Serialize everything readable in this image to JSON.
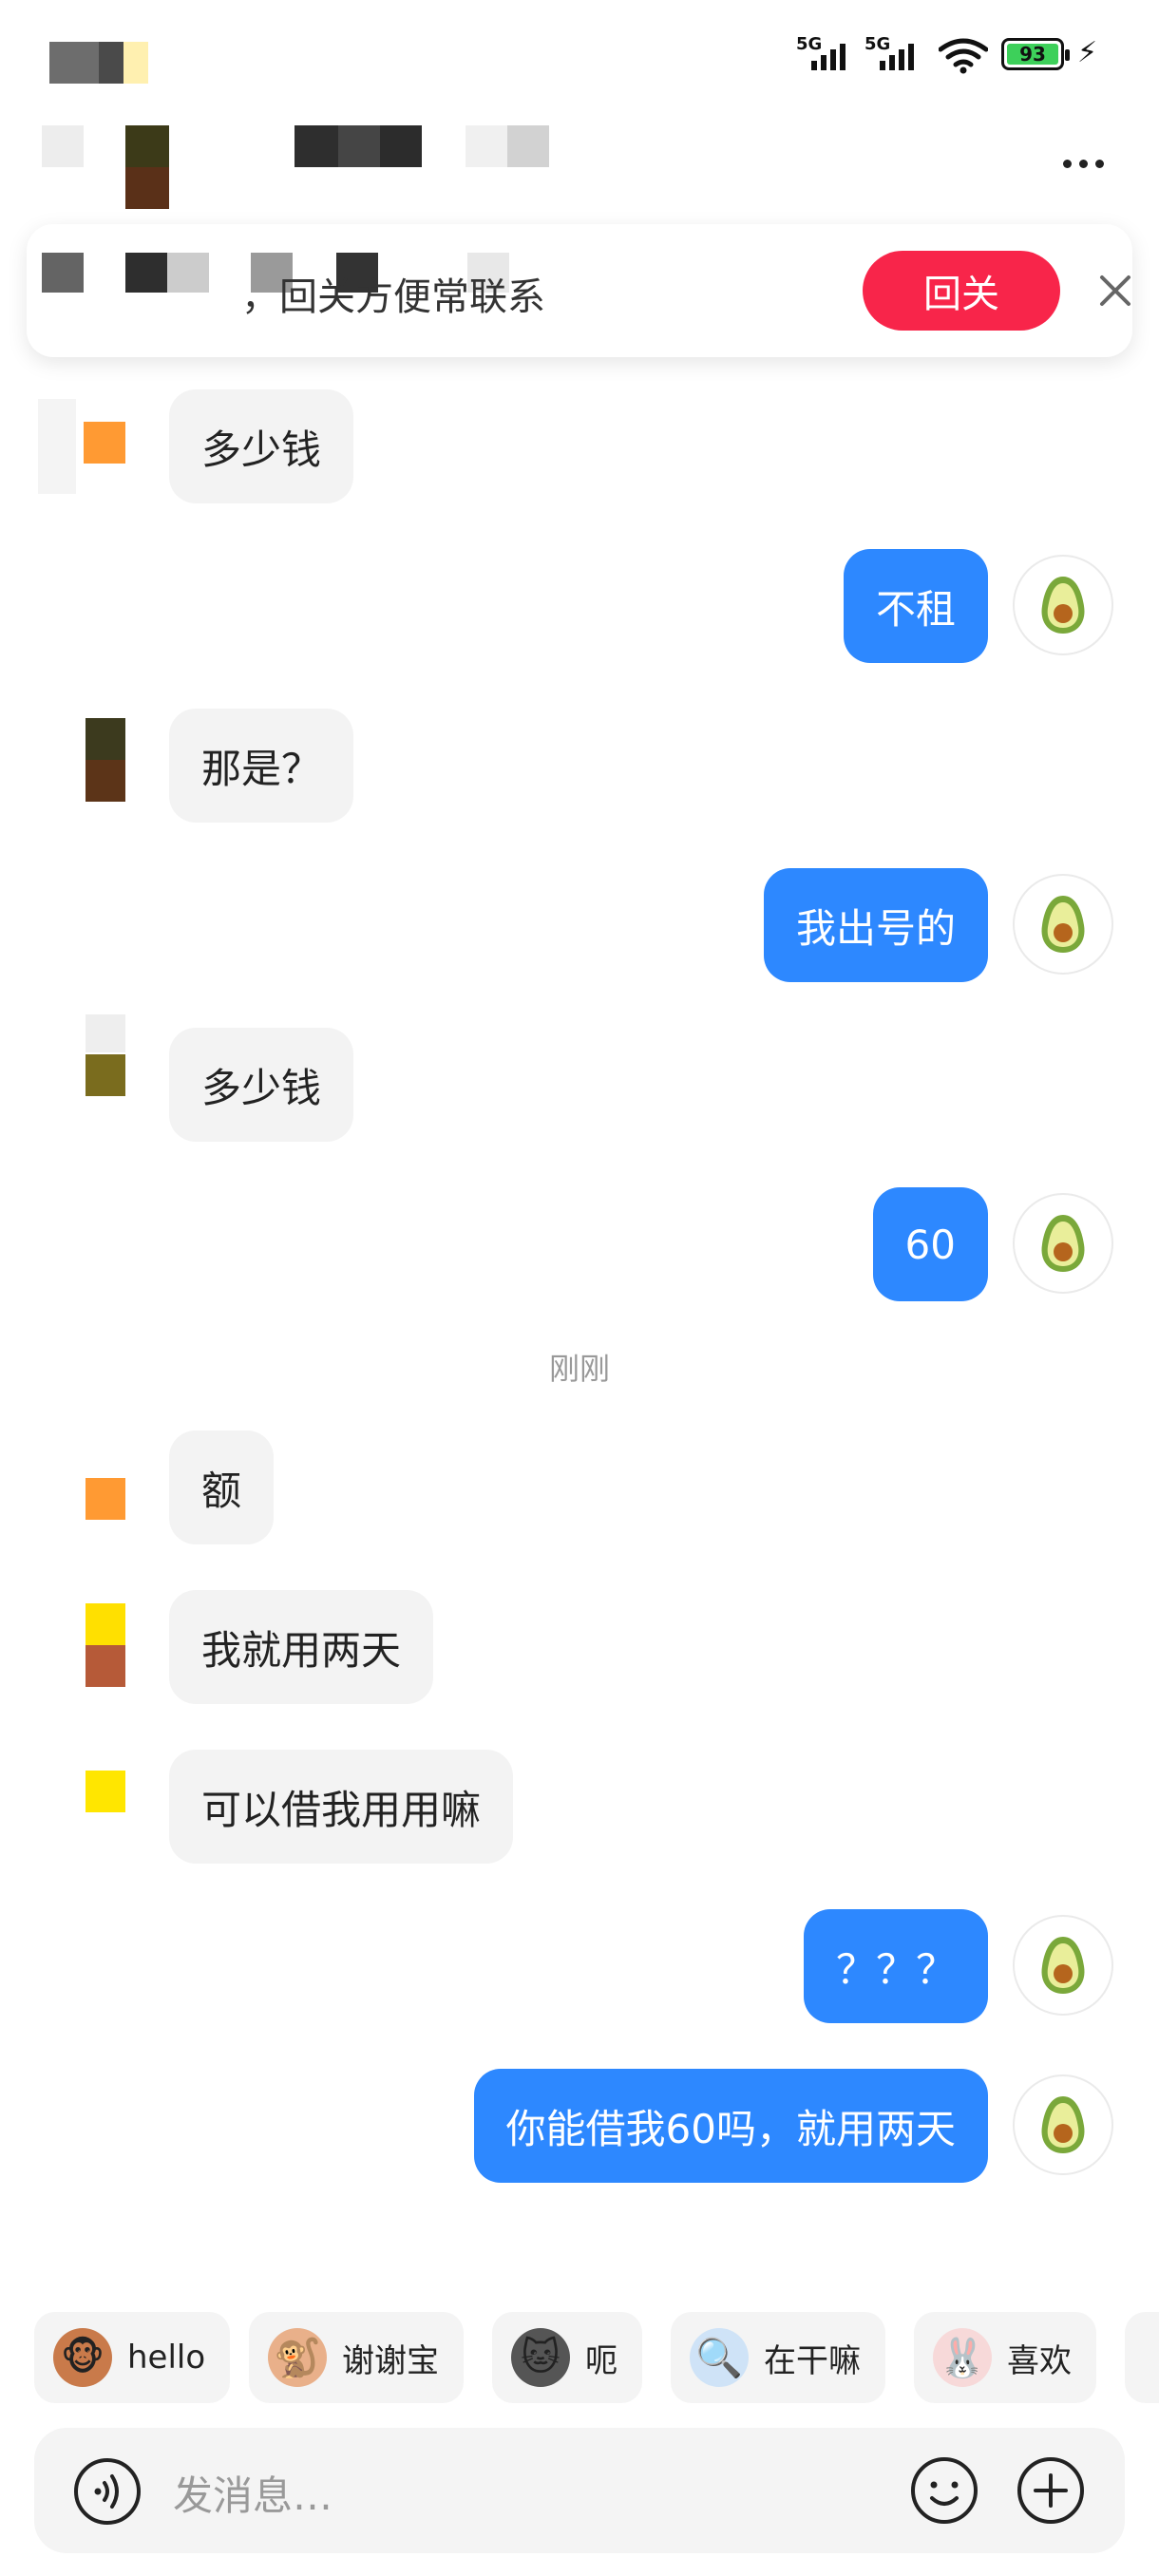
{
  "status_bar": {
    "network_1": "5G",
    "network_2": "5G",
    "battery_level": "93",
    "wifi_icon": "wifi-icon",
    "charging_icon": "bolt-icon"
  },
  "header": {
    "more_icon": "more-dots-icon"
  },
  "follow_banner": {
    "text": "，回关方便常联系",
    "button_label": "回关",
    "close_icon": "close-icon",
    "button_color": "#f8254a"
  },
  "messages": [
    {
      "side": "left",
      "text": "多少钱"
    },
    {
      "side": "right",
      "text": "不租"
    },
    {
      "side": "left",
      "text": "那是？"
    },
    {
      "side": "right",
      "text": "我出号的"
    },
    {
      "side": "left",
      "text": "多少钱"
    },
    {
      "side": "right",
      "text": "60"
    },
    {
      "side": "left",
      "text": "额"
    },
    {
      "side": "left",
      "text": "我就用两天"
    },
    {
      "side": "left",
      "text": "可以借我用用嘛"
    },
    {
      "side": "right",
      "text": "？？？"
    },
    {
      "side": "right",
      "text": "你能借我60吗，就用两天"
    }
  ],
  "time_divider": "刚刚",
  "quick_replies": [
    {
      "label": "hello",
      "icon": "monkey-hello-icon"
    },
    {
      "label": "谢谢宝",
      "icon": "monkey-thanks-icon"
    },
    {
      "label": "呃",
      "icon": "cat-icon"
    },
    {
      "label": "在干嘛",
      "icon": "bear-magnifier-icon"
    },
    {
      "label": "喜欢",
      "icon": "bunny-like-icon"
    }
  ],
  "input": {
    "placeholder": "发消息…",
    "voice_icon": "voice-icon",
    "emoji_icon": "emoji-icon",
    "plus_icon": "plus-icon"
  },
  "colors": {
    "self_bubble": "#2d88ff",
    "other_bubble": "#f3f3f3",
    "avatar_self": "avocado"
  }
}
